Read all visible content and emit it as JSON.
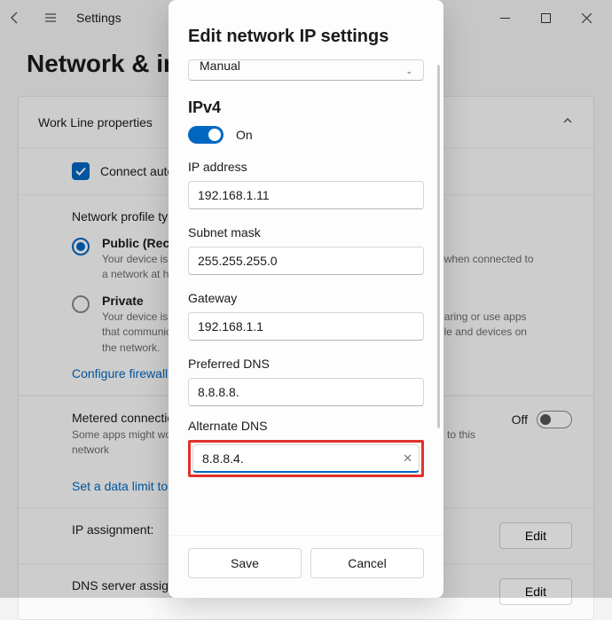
{
  "header": {
    "app_title": "Settings",
    "page_title": "Network & internet  ›  Work Line"
  },
  "card": {
    "header": "Work Line properties",
    "connect_auto": "Connect automatically when in range",
    "profile_type_label": "Network profile type",
    "public": {
      "title": "Public (Recommended)",
      "desc": "Your device is not discoverable on the network. Use this in most cases—when connected to a network at home, work, or in a public place."
    },
    "private": {
      "title": "Private",
      "desc": "Your device is discoverable on the network. Select this if you need file sharing or use apps that communicate over this network. You should know and trust the people and devices on the network."
    },
    "firewall_link": "Configure firewall and security settings",
    "metered": {
      "title": "Metered connection",
      "sub": "Some apps might work differently to reduce data usage when you're connected to this network",
      "state": "Off"
    },
    "data_limit_link": "Set a data limit to help control data usage on this network",
    "ip_assignment": "IP assignment:",
    "dns_assignment": "DNS server assignment:",
    "edit": "Edit"
  },
  "modal": {
    "title": "Edit network IP settings",
    "mode": "Manual",
    "ipv4_heading": "IPv4",
    "toggle_label": "On",
    "fields": {
      "ip_label": "IP address",
      "ip_value": "192.168.1.11",
      "subnet_label": "Subnet mask",
      "subnet_value": "255.255.255.0",
      "gateway_label": "Gateway",
      "gateway_value": "192.168.1.1",
      "dns1_label": "Preferred DNS",
      "dns1_value": "8.8.8.8.",
      "dns2_label": "Alternate DNS",
      "dns2_value": "8.8.8.4."
    },
    "save": "Save",
    "cancel": "Cancel"
  }
}
